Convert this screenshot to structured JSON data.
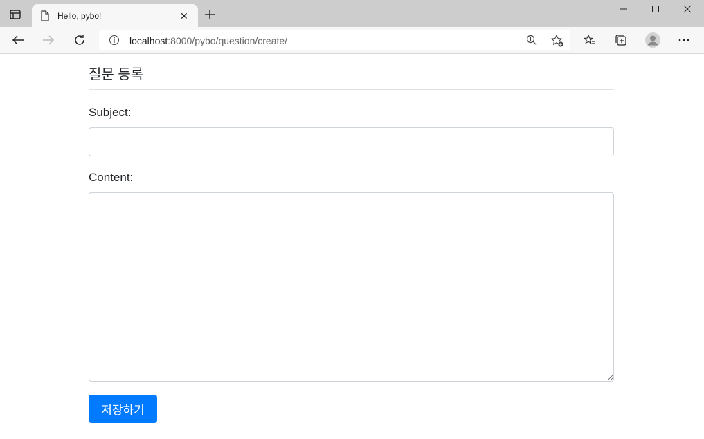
{
  "browser": {
    "tab": {
      "title": "Hello, pybo!",
      "close": "✕",
      "favicon": "page-icon"
    },
    "url": {
      "host": "localhost",
      "rest": ":8000/pybo/question/create/"
    },
    "icons": [
      "tab-actions-icon",
      "new-tab-icon",
      "minimize-icon",
      "maximize-icon",
      "window-close-icon",
      "back-icon",
      "forward-icon",
      "refresh-icon",
      "info-icon",
      "zoom-icon",
      "add-favorite-icon",
      "favorites-icon",
      "collections-icon",
      "profile-icon",
      "more-icon"
    ]
  },
  "page": {
    "title": "질문 등록",
    "subject_label": "Subject:",
    "content_label": "Content:",
    "submit_label": "저장하기"
  },
  "colors": {
    "primary": "#007bff",
    "border": "#ced4da",
    "divider": "#dee2e6",
    "tabstrip": "#cdcdcd",
    "toolbar": "#f7f7f7"
  }
}
